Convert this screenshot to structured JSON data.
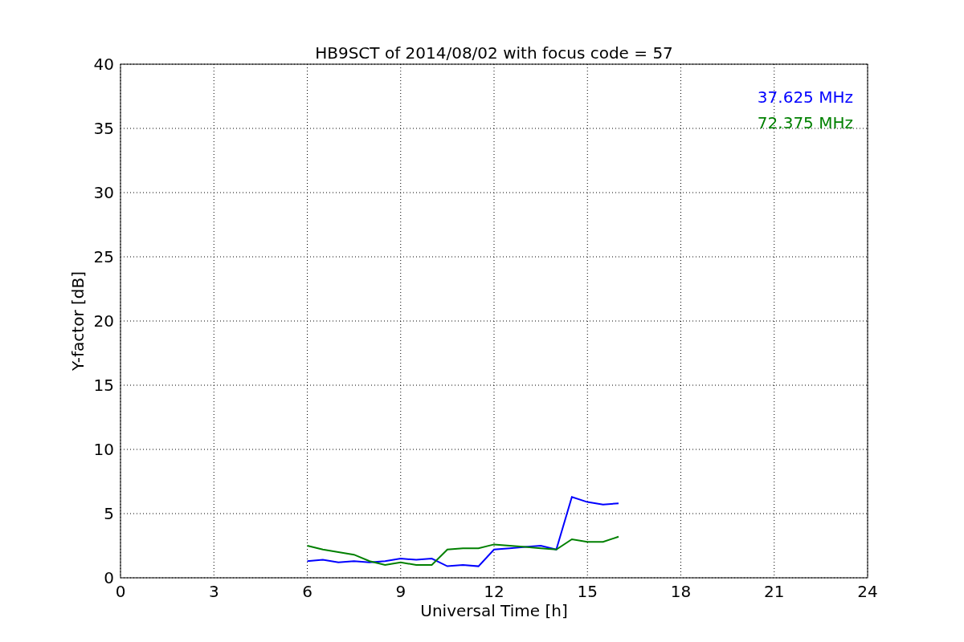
{
  "chart_data": {
    "type": "line",
    "title": "HB9SCT of 2014/08/02 with focus code = 57",
    "xlabel": "Universal Time [h]",
    "ylabel": "Y-factor [dB]",
    "x": [
      6,
      6.5,
      7,
      7.5,
      8,
      8.5,
      9,
      9.5,
      10,
      10.5,
      11,
      11.5,
      12,
      12.5,
      13,
      13.5,
      14,
      14.5,
      15,
      15.5,
      16
    ],
    "series": [
      {
        "name": "37.625 MHz",
        "color": "#0000ff",
        "values": [
          1.3,
          1.4,
          1.2,
          1.3,
          1.2,
          1.3,
          1.5,
          1.4,
          1.5,
          0.9,
          1.0,
          0.9,
          2.2,
          2.3,
          2.4,
          2.5,
          2.2,
          6.3,
          5.9,
          5.7,
          5.8
        ]
      },
      {
        "name": "72.375 MHz",
        "color": "#008000",
        "values": [
          2.5,
          2.2,
          2.0,
          1.8,
          1.3,
          1.0,
          1.2,
          1.0,
          1.0,
          2.2,
          2.3,
          2.3,
          2.6,
          2.5,
          2.4,
          2.3,
          2.2,
          3.0,
          2.8,
          2.8,
          3.2
        ]
      }
    ],
    "grid": true,
    "xlim": [
      0,
      24
    ],
    "ylim": [
      0,
      40
    ],
    "xticks": [
      0,
      3,
      6,
      9,
      12,
      15,
      18,
      21,
      24
    ],
    "yticks": [
      0,
      5,
      10,
      15,
      20,
      25,
      30,
      35,
      40
    ]
  }
}
